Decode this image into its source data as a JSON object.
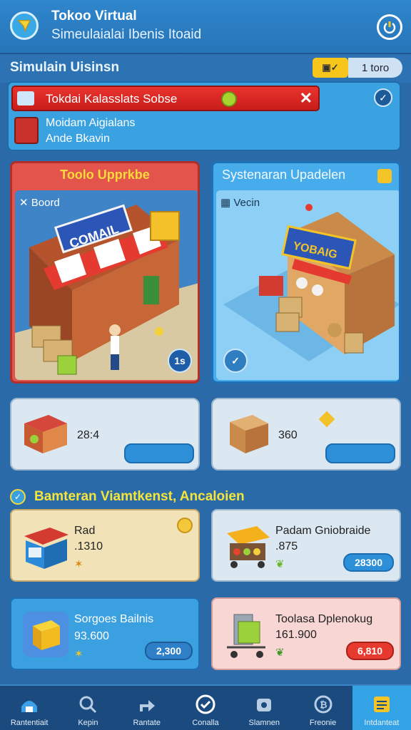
{
  "header": {
    "title": "Tokoo Virtual",
    "subtitle": "Simeulaialai Ibenis Itoaid"
  },
  "section": {
    "title": "Simulain Uisinsn",
    "toggle_label": "1 toro"
  },
  "notice": {
    "bar_text": "Tokdai Kalasslats Sobse",
    "close_label": "✕",
    "line1": "Moidam Aigialans",
    "line2": "Ande Bkavin"
  },
  "cards": [
    {
      "title": "Toolo Upprkbe",
      "scene_label": "Boord",
      "button_label": "1s",
      "sign": "COMAIL"
    },
    {
      "title": "Systenaran Upadelen",
      "scene_label": "Vecin",
      "sign": "YOBAIG"
    }
  ],
  "mini_cards": [
    {
      "value": "28:4"
    },
    {
      "value": "360"
    }
  ],
  "shop": {
    "header_text": "Bamteran Viamtkenst, Ancaloien",
    "items": [
      {
        "name": "Rad",
        "price": ".1310",
        "button_label": ""
      },
      {
        "name": "Padam Gniobraide",
        "price": ".875",
        "button_label": "28300"
      },
      {
        "name": "Sorgoes Bailnis",
        "price": "93.600",
        "button_label": "2,300"
      },
      {
        "name": "Toolasa Dplenokug",
        "price": "161.900",
        "button_label": "6,810"
      }
    ]
  },
  "nav": [
    {
      "label": "Rantentiait",
      "icon": "store-icon"
    },
    {
      "label": "Kepin",
      "icon": "search-icon"
    },
    {
      "label": "Rantate",
      "icon": "trade-icon"
    },
    {
      "label": "Conalla",
      "icon": "check-icon"
    },
    {
      "label": "Slamnen",
      "icon": "bag-icon"
    },
    {
      "label": "Freonie",
      "icon": "coin-icon"
    },
    {
      "label": "Intdanteat",
      "icon": "report-icon"
    }
  ],
  "colors": {
    "background": "#2a6aa8",
    "accent_yellow": "#f5e43a",
    "red_card": "#e2544c",
    "blue_card": "#46acec"
  }
}
